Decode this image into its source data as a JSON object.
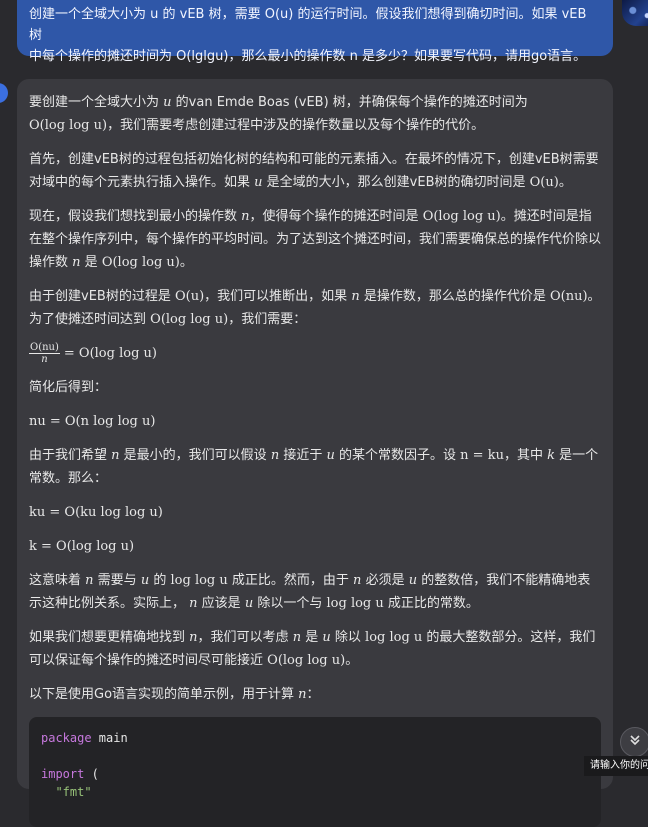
{
  "user_message": {
    "line1": "创建一个全域大小为 u 的 vEB 树，需要 O(u) 的运行时间。假设我们想得到确切时间。如果 vEB 树",
    "line2": "中每个操作的摊还时间为 O(lglgu)，那么最小的操作数 n 是多少？如果要写代码，请用go语言。"
  },
  "answer": {
    "p1_a": "要创建一个全域大小为",
    "p1_b": "的van Emde Boas (vEB) 树，并确保每个操作的摊还时间为",
    "p1_c": "，我们需要考虑创建过程中涉及的操作数量以及每个操作的代价。",
    "p2_a": "首先，创建vEB树的过程包括初始化树的结构和可能的元素插入。在最坏的情况下，创建vEB树需要对域中的每个元素执行插入操作。如果",
    "p2_b": "是全域的大小，那么创建vEB树的确切时间是",
    "p3_a": "现在，假设我们想找到最小的操作数",
    "p3_b": "，使得每个操作的摊还时间是",
    "p3_c": "。摊还时间是指在整个操作序列中，每个操作的平均时间。为了达到这个摊还时间，我们需要确保总的操作代价除以操作数",
    "p3_d": "是",
    "p4_a": "由于创建vEB树的过程是",
    "p4_b": "，我们可以推断出，如果",
    "p4_c": "是操作数，那么总的操作代价是",
    "p4_d": "。为了使摊还时间达到",
    "p4_e": "，我们需要：",
    "simplify": "简化后得到：",
    "p5_a": "由于我们希望",
    "p5_b": "是最小的，我们可以假设",
    "p5_c": "接近于",
    "p5_d": "的某个常数因子。设",
    "p5_e": "，其中",
    "p5_f": "是一个常数。那么：",
    "p6_a": "这意味着",
    "p6_b": "需要与",
    "p6_c": "的",
    "p6_d": "成正比。然而，由于",
    "p6_e": "必须是",
    "p6_f": "的整数倍，我们不能精确地表示这种比例关系。实际上，",
    "p6_g": "应该是",
    "p6_h": "除以一个与",
    "p6_i": "成正比的常数。",
    "p7_a": "如果我们想要更精确地找到",
    "p7_b": "，我们可以考虑",
    "p7_c": "是",
    "p7_d": "除以",
    "p7_e": "的最大整数部分。这样，我们可以保证每个操作的摊还时间尽可能接近",
    "p7_f": "。",
    "p8": "以下是使用Go语言实现的简单示例，用于计算",
    "p8_end": "："
  },
  "math": {
    "u": "u",
    "n": "n",
    "k": "k",
    "O_loglog_u": "O(log log u)",
    "O_u": "O(u)",
    "O_nu": "O(nu)",
    "frac_num": "O(nu)",
    "frac_den": "n",
    "frac_rhs": "= O(log log u)",
    "eq_nu": "nu = O(n log log u)",
    "eq_n_ku": "n = ku",
    "eq_ku": "ku = O(ku log log u)",
    "eq_k": "k = O(log log u)",
    "loglog_u": "log log u",
    "loglog_u_paren": "O(log log u)"
  },
  "code": {
    "line1_kw": "package",
    "line1_rest": " main",
    "line3_kw": "import",
    "line3_rest": " (",
    "line4_str": "\"fmt\""
  },
  "tooltip": "请输入你的问",
  "icons": {
    "scroll": "chevron-double-down-icon",
    "avatar": "user-avatar"
  }
}
